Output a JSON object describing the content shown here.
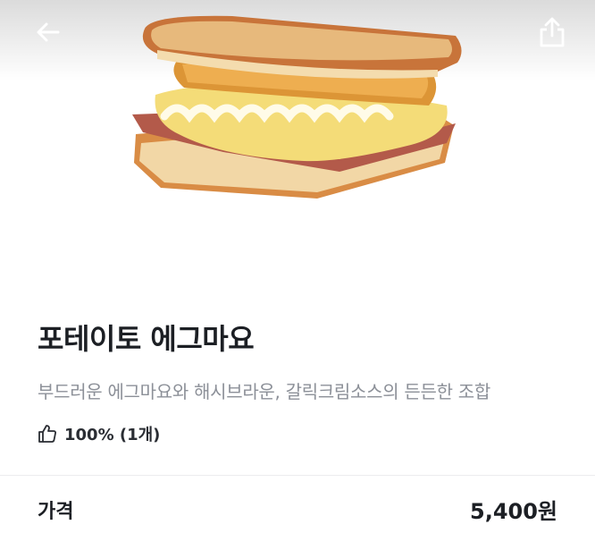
{
  "header": {
    "back_icon": "arrow-left-icon",
    "share_icon": "share-icon"
  },
  "product": {
    "name": "포테이토 에그마요",
    "description": "부드러운 에그마요와 해시브라운, 갈릭크림소스의 든든한 조합",
    "rating": "100% (1개)",
    "rating_icon": "thumbs-up-icon"
  },
  "price": {
    "label": "가격",
    "value": "5,400원"
  }
}
